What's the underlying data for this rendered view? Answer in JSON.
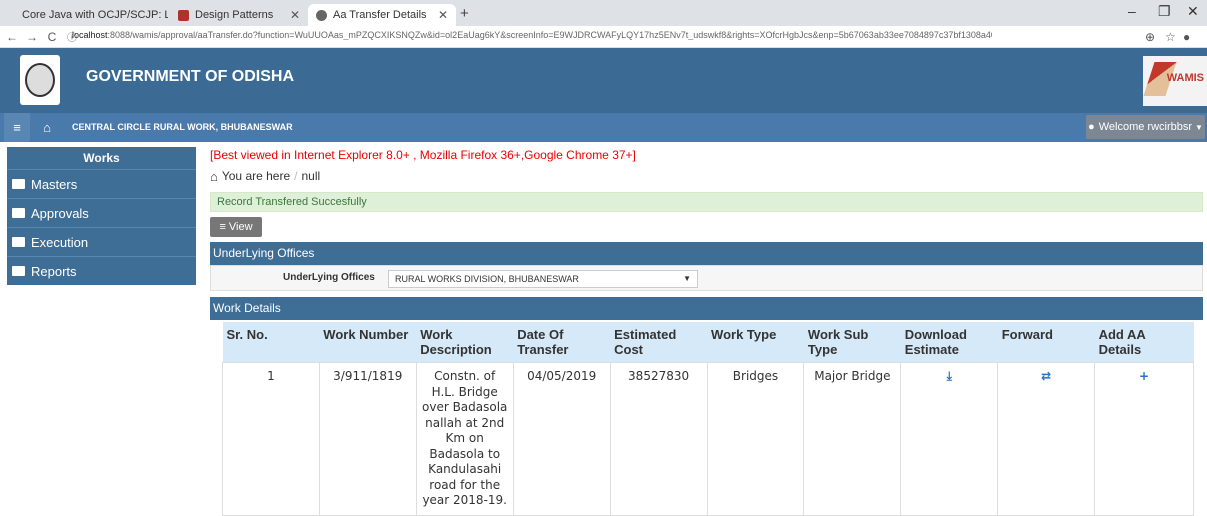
{
  "browser": {
    "tabs": [
      {
        "title": "Core Java with OCJP/SCJP: L",
        "active": false
      },
      {
        "title": "Design Patterns",
        "active": false
      },
      {
        "title": "Aa Transfer Details",
        "active": true
      }
    ],
    "url_host": "localhost",
    "url_rest": ":8088/wamis/approval/aaTransfer.do?function=WuUUOAas_mPZQCXIKSNQZw&id=ol2EaUag6kY&screenInfo=E9WJDRCWAFyLQY17hz5ENv7t_udswkf8&rights=XOfcrHgbJcs&enp=5b67063ab33ee7084897c37bf1308a40"
  },
  "header": {
    "title": "GOVERNMENT OF ODISHA",
    "logo_right_text": "WAMIS"
  },
  "navbar": {
    "circle": "CENTRAL CIRCLE RURAL WORK, BHUBANESWAR",
    "welcome": "Welcome rwcirbbsr"
  },
  "sidebar": {
    "title": "Works",
    "items": [
      {
        "label": "Masters"
      },
      {
        "label": "Approvals"
      },
      {
        "label": "Execution"
      },
      {
        "label": "Reports"
      }
    ]
  },
  "main": {
    "browser_note": "[Best viewed in Internet Explorer 8.0+ , Mozilla Firefox 36+,Google Chrome 37+]",
    "breadcrumb": {
      "prefix": "You are here",
      "sep": "/",
      "current": "null"
    },
    "alert": "Record Transfered Succesfully",
    "view_button": "View",
    "underlying_panel_title": "UnderLying Offices",
    "underlying_label": "UnderLying Offices",
    "underlying_value": "RURAL WORKS DIVISION, BHUBANESWAR",
    "work_panel_title": "Work Details"
  },
  "table": {
    "headers": [
      "Sr. No.",
      "Work Number",
      "Work Description",
      "Date Of Transfer",
      "Estimated Cost",
      "Work Type",
      "Work Sub Type",
      "Download Estimate",
      "Forward",
      "Add AA Details"
    ],
    "row": {
      "sr": "1",
      "work_number": "3/911/1819",
      "description": "Constn. of H.L. Bridge over Badasola nallah at 2nd Km on Badasola to Kandulasahi road for the year 2018-19.",
      "date": "04/05/2019",
      "cost": "38527830",
      "type": "Bridges",
      "sub_type": "Major Bridge",
      "download_icon": "download-icon",
      "forward_icon": "transfer-icon",
      "add_icon": "plus-icon"
    }
  }
}
